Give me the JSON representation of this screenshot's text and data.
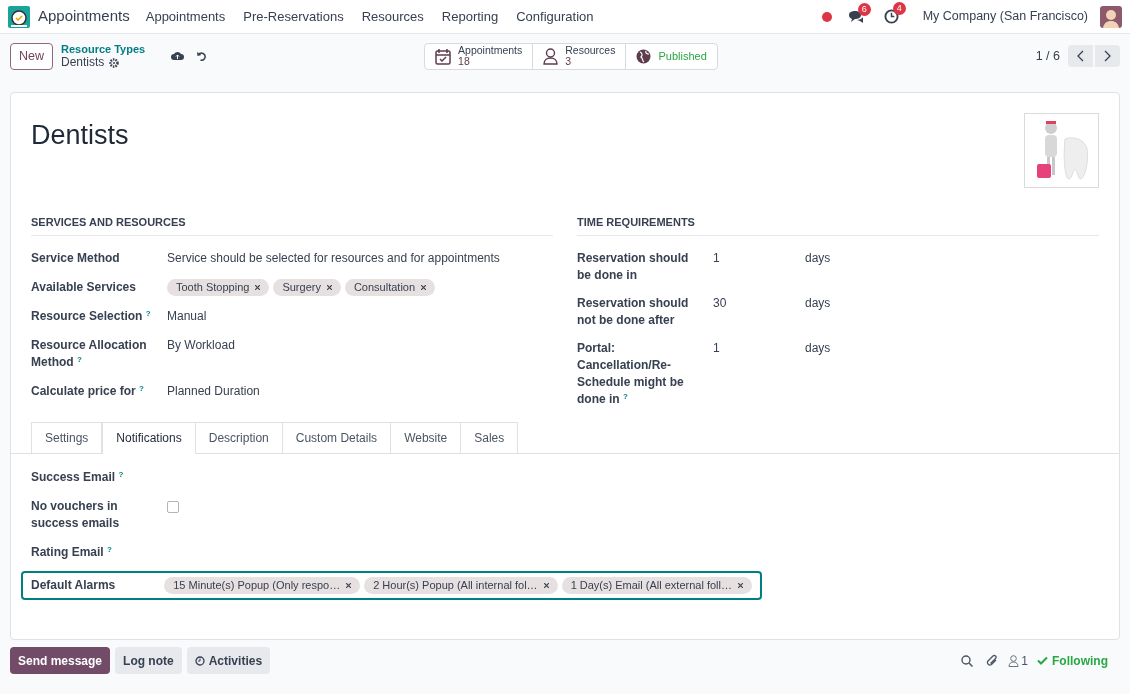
{
  "navbar": {
    "app_name": "Appointments",
    "menu": [
      "Appointments",
      "Pre-Reservations",
      "Resources",
      "Reporting",
      "Configuration"
    ],
    "messages_badge": "6",
    "activities_badge": "4",
    "company": "My Company (San Francisco)"
  },
  "control_panel": {
    "new_button": "New",
    "breadcrumb_parent": "Resource Types",
    "breadcrumb_current": "Dentists",
    "smart_buttons": [
      {
        "kind": "calendar",
        "label": "Appointments",
        "value": "18"
      },
      {
        "kind": "person",
        "label": "Resources",
        "value": "3"
      },
      {
        "kind": "globe",
        "label": "Published"
      }
    ],
    "pager": "1 / 6"
  },
  "form": {
    "title": "Dentists",
    "left_section": {
      "heading": "SERVICES AND RESOURCES",
      "fields": [
        {
          "label": "Service Method",
          "kind": "text",
          "value": "Service should be selected for resources and for appointments"
        },
        {
          "label": "Available Services",
          "kind": "tags",
          "tags": [
            "Tooth Stopping",
            "Surgery",
            "Consultation"
          ]
        },
        {
          "label": "Resource Selection",
          "help": "?",
          "kind": "text",
          "value": "Manual"
        },
        {
          "label": "Resource Allocation Method",
          "help": "?",
          "kind": "text",
          "value": "By Workload"
        },
        {
          "label": "Calculate price for",
          "help": "?",
          "kind": "text",
          "value": "Planned Duration"
        }
      ]
    },
    "right_section": {
      "heading": "TIME REQUIREMENTS",
      "fields": [
        {
          "label": "Reservation should be done in",
          "value": "1",
          "unit": "days"
        },
        {
          "label": "Reservation should not be done after",
          "value": "30",
          "unit": "days"
        },
        {
          "label": "Portal: Cancellation/Re-Schedule might be done in",
          "help": "?",
          "value": "1",
          "unit": "days"
        }
      ]
    },
    "tabs": [
      {
        "label": "Settings",
        "selected": false
      },
      {
        "label": "Notifications",
        "selected": true
      },
      {
        "label": "Description",
        "selected": false
      },
      {
        "label": "Custom Details",
        "selected": false
      },
      {
        "label": "Website",
        "selected": false
      },
      {
        "label": "Sales",
        "selected": false
      }
    ],
    "notification_fields": [
      {
        "label": "Success Email",
        "help": "?",
        "kind": "empty"
      },
      {
        "label": "No vouchers in success emails",
        "kind": "checkbox",
        "checked": false
      },
      {
        "label": "Rating Email",
        "help": "?",
        "kind": "empty"
      },
      {
        "label": "Default Alarms",
        "kind": "tags",
        "focused": true,
        "tags": [
          "15 Minute(s) Popup (Only respo…",
          "2 Hour(s) Popup (All internal fol…",
          "1 Day(s) Email (All external foll…"
        ]
      }
    ]
  },
  "chatter": {
    "buttons": [
      "Send message",
      "Log note",
      "Activities"
    ],
    "followers": "1",
    "following": "Following"
  }
}
